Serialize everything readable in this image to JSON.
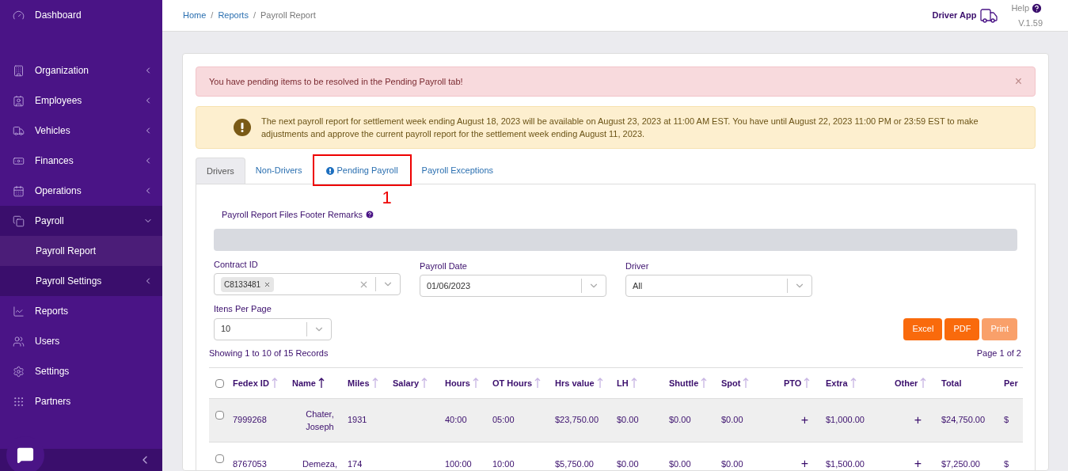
{
  "sidebar": {
    "items": [
      {
        "label": "Dashboard",
        "selected": false
      },
      {
        "label": "Organization",
        "selected": false,
        "expanded": false
      },
      {
        "label": "Employees",
        "selected": false,
        "expanded": false
      },
      {
        "label": "Vehicles",
        "selected": false,
        "expanded": false
      },
      {
        "label": "Finances",
        "selected": false,
        "expanded": false
      },
      {
        "label": "Operations",
        "selected": false,
        "expanded": false
      },
      {
        "label": "Payroll",
        "selected": true,
        "expanded": true,
        "children": [
          {
            "label": "Payroll Report",
            "selected": true
          },
          {
            "label": "Payroll Settings",
            "selected": false,
            "expanded": false
          }
        ]
      },
      {
        "label": "Reports",
        "selected": false
      },
      {
        "label": "Users",
        "selected": false
      },
      {
        "label": "Settings",
        "selected": false
      },
      {
        "label": "Partners",
        "selected": false
      }
    ]
  },
  "breadcrumb": {
    "separator": "/",
    "items": [
      "Home",
      "Reports",
      "Payroll Report"
    ]
  },
  "header": {
    "driver_app": "Driver App",
    "help": "Help",
    "version": "V.1.59"
  },
  "alerts": [
    {
      "kind": "danger",
      "text": "You have pending items to be resolved in the Pending Payroll tab!",
      "close": "×"
    },
    {
      "kind": "warning",
      "text": "The next payroll report for settlement week ending August 18, 2023 will be available on August 23, 2023 at 11:00 AM EST. You have until August 22, 2023 11:00 PM or 23:59 EST to make adjustments and approve the current payroll report for the settlement week ending August 11, 2023."
    }
  ],
  "tabs": [
    {
      "label": "Drivers",
      "selected": true,
      "alert": false,
      "annotated": false
    },
    {
      "label": "Non-Drivers",
      "selected": false,
      "alert": false,
      "annotated": false
    },
    {
      "label": "Pending Payroll",
      "selected": false,
      "alert": true,
      "annotated": true
    },
    {
      "label": "Payroll Exceptions",
      "selected": false,
      "alert": false,
      "annotated": false
    }
  ],
  "annotation": {
    "label": "1"
  },
  "remarks": {
    "label": "Payroll Report Files Footer Remarks"
  },
  "filters": [
    {
      "label": "Contract ID",
      "tag": "C8133481",
      "clearable": true
    },
    {
      "label": "Payroll Date",
      "clearable": false,
      "value": "01/06/2023"
    },
    {
      "label": "Driver",
      "clearable": false,
      "value": "All"
    }
  ],
  "per_page": {
    "label": "Itens Per Page",
    "value": "10"
  },
  "exports": [
    {
      "label": "Excel",
      "disabled": false
    },
    {
      "label": "PDF",
      "disabled": false
    },
    {
      "label": "Print",
      "disabled": true
    }
  ],
  "showing": "Showing 1 to 10 of 15 Records",
  "page": "Page 1 of 2",
  "table": {
    "all_checked": false,
    "columns": [
      {
        "label": "Fedex ID",
        "sorted": false
      },
      {
        "label": "Name",
        "sorted": true
      },
      {
        "label": "Miles",
        "sorted": false
      },
      {
        "label": "Salary",
        "sorted": false
      },
      {
        "label": "Hours",
        "sorted": false
      },
      {
        "label": "OT Hours",
        "sorted": false
      },
      {
        "label": "Hrs value",
        "sorted": false
      },
      {
        "label": "LH",
        "sorted": false
      },
      {
        "label": "Shuttle",
        "sorted": false
      },
      {
        "label": "Spot",
        "sorted": false
      },
      {
        "label": "PTO",
        "sorted": false
      },
      {
        "label": "Extra",
        "sorted": false
      },
      {
        "label": "Other",
        "sorted": false
      },
      {
        "label": "Total"
      },
      {
        "label": "Per"
      }
    ],
    "rows": [
      {
        "highlighted": true,
        "checked": false,
        "cells": [
          "7999268",
          "Chater, Joseph",
          "1931",
          "",
          "40:00",
          "05:00",
          "$23,750.00",
          "$0.00",
          "$0.00",
          "$0.00",
          "+",
          "$1,000.00",
          "+",
          "$24,750.00",
          "$"
        ]
      },
      {
        "highlighted": false,
        "checked": false,
        "cells": [
          "8767053",
          "Demeza,",
          "174",
          "",
          "100:00",
          "10:00",
          "$5,750.00",
          "$0.00",
          "$0.00",
          "$0.00",
          "+",
          "$1,500.00",
          "+",
          "$7,250.00",
          "$"
        ]
      }
    ]
  }
}
